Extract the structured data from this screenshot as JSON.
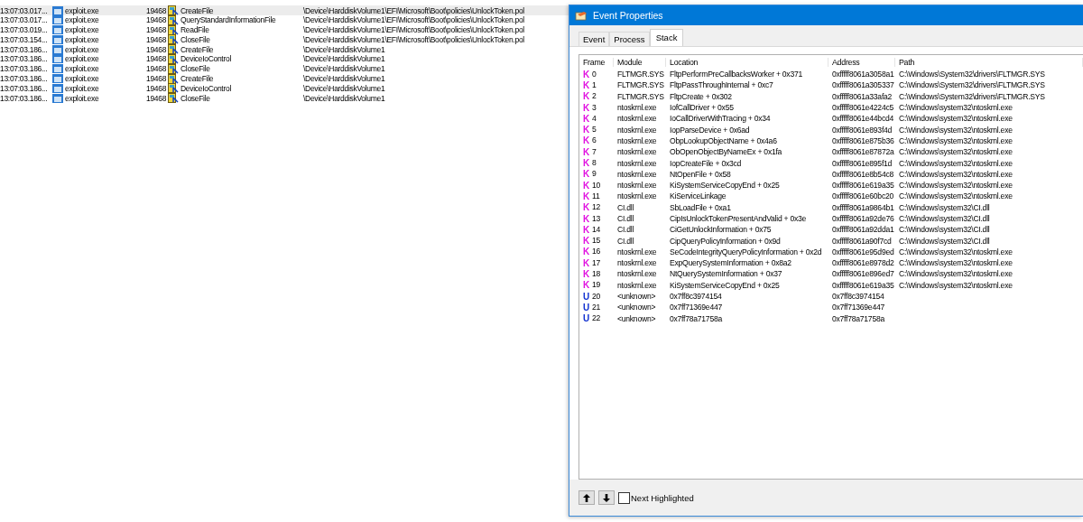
{
  "event_log": {
    "rows": [
      {
        "time": "13:07:03.017...",
        "process": "exploit.exe",
        "pid": "19468",
        "operation": "CreateFile",
        "path": "\\Device\\HarddiskVolume1\\EFI\\Microsoft\\Boot\\policies\\UnlockToken.pol",
        "selected": true
      },
      {
        "time": "13:07:03.017...",
        "process": "exploit.exe",
        "pid": "19468",
        "operation": "QueryStandardInformationFile",
        "path": "\\Device\\HarddiskVolume1\\EFI\\Microsoft\\Boot\\policies\\UnlockToken.pol",
        "selected": false
      },
      {
        "time": "13:07:03.019...",
        "process": "exploit.exe",
        "pid": "19468",
        "operation": "ReadFile",
        "path": "\\Device\\HarddiskVolume1\\EFI\\Microsoft\\Boot\\policies\\UnlockToken.pol",
        "selected": false
      },
      {
        "time": "13:07:03.154...",
        "process": "exploit.exe",
        "pid": "19468",
        "operation": "CloseFile",
        "path": "\\Device\\HarddiskVolume1\\EFI\\Microsoft\\Boot\\policies\\UnlockToken.pol",
        "selected": false
      },
      {
        "time": "13:07:03.186...",
        "process": "exploit.exe",
        "pid": "19468",
        "operation": "CreateFile",
        "path": "\\Device\\HarddiskVolume1",
        "selected": false
      },
      {
        "time": "13:07:03.186...",
        "process": "exploit.exe",
        "pid": "19468",
        "operation": "DeviceIoControl",
        "path": "\\Device\\HarddiskVolume1",
        "selected": false
      },
      {
        "time": "13:07:03.186...",
        "process": "exploit.exe",
        "pid": "19468",
        "operation": "CloseFile",
        "path": "\\Device\\HarddiskVolume1",
        "selected": false
      },
      {
        "time": "13:07:03.186...",
        "process": "exploit.exe",
        "pid": "19468",
        "operation": "CreateFile",
        "path": "\\Device\\HarddiskVolume1",
        "selected": false
      },
      {
        "time": "13:07:03.186...",
        "process": "exploit.exe",
        "pid": "19468",
        "operation": "DeviceIoControl",
        "path": "\\Device\\HarddiskVolume1",
        "selected": false
      },
      {
        "time": "13:07:03.186...",
        "process": "exploit.exe",
        "pid": "19468",
        "operation": "CloseFile",
        "path": "\\Device\\HarddiskVolume1",
        "selected": false
      }
    ]
  },
  "dialog": {
    "title": "Event Properties",
    "tabs": [
      {
        "label": "Event",
        "selected": false
      },
      {
        "label": "Process",
        "selected": false
      },
      {
        "label": "Stack",
        "selected": true
      }
    ],
    "stack": {
      "columns": [
        "Frame",
        "Module",
        "Location",
        "Address",
        "Path"
      ],
      "rows": [
        {
          "mode": "K",
          "color": "#e010e0",
          "frame": "0",
          "module": "FLTMGR.SYS",
          "location": "FltpPerformPreCallbacksWorker + 0x371",
          "address": "0xfffff8061a3058a1",
          "path": "C:\\Windows\\System32\\drivers\\FLTMGR.SYS"
        },
        {
          "mode": "K",
          "color": "#e010e0",
          "frame": "1",
          "module": "FLTMGR.SYS",
          "location": "FltpPassThroughInternal + 0xc7",
          "address": "0xfffff8061a305337",
          "path": "C:\\Windows\\System32\\drivers\\FLTMGR.SYS"
        },
        {
          "mode": "K",
          "color": "#e010e0",
          "frame": "2",
          "module": "FLTMGR.SYS",
          "location": "FltpCreate + 0x302",
          "address": "0xfffff8061a33afa2",
          "path": "C:\\Windows\\System32\\drivers\\FLTMGR.SYS"
        },
        {
          "mode": "K",
          "color": "#e010e0",
          "frame": "3",
          "module": "ntoskrnl.exe",
          "location": "IofCallDriver + 0x55",
          "address": "0xfffff8061e4224c5",
          "path": "C:\\Windows\\system32\\ntoskrnl.exe"
        },
        {
          "mode": "K",
          "color": "#e010e0",
          "frame": "4",
          "module": "ntoskrnl.exe",
          "location": "IoCallDriverWithTracing + 0x34",
          "address": "0xfffff8061e44bcd4",
          "path": "C:\\Windows\\system32\\ntoskrnl.exe"
        },
        {
          "mode": "K",
          "color": "#e010e0",
          "frame": "5",
          "module": "ntoskrnl.exe",
          "location": "IopParseDevice + 0x6ad",
          "address": "0xfffff8061e893f4d",
          "path": "C:\\Windows\\system32\\ntoskrnl.exe"
        },
        {
          "mode": "K",
          "color": "#e010e0",
          "frame": "6",
          "module": "ntoskrnl.exe",
          "location": "ObpLookupObjectName + 0x4a6",
          "address": "0xfffff8061e875b36",
          "path": "C:\\Windows\\system32\\ntoskrnl.exe"
        },
        {
          "mode": "K",
          "color": "#e010e0",
          "frame": "7",
          "module": "ntoskrnl.exe",
          "location": "ObOpenObjectByNameEx + 0x1fa",
          "address": "0xfffff8061e87872a",
          "path": "C:\\Windows\\system32\\ntoskrnl.exe"
        },
        {
          "mode": "K",
          "color": "#e010e0",
          "frame": "8",
          "module": "ntoskrnl.exe",
          "location": "IopCreateFile + 0x3cd",
          "address": "0xfffff8061e895f1d",
          "path": "C:\\Windows\\system32\\ntoskrnl.exe"
        },
        {
          "mode": "K",
          "color": "#e010e0",
          "frame": "9",
          "module": "ntoskrnl.exe",
          "location": "NtOpenFile + 0x58",
          "address": "0xfffff8061e8b54c8",
          "path": "C:\\Windows\\system32\\ntoskrnl.exe"
        },
        {
          "mode": "K",
          "color": "#e010e0",
          "frame": "10",
          "module": "ntoskrnl.exe",
          "location": "KiSystemServiceCopyEnd + 0x25",
          "address": "0xfffff8061e619a35",
          "path": "C:\\Windows\\system32\\ntoskrnl.exe"
        },
        {
          "mode": "K",
          "color": "#e010e0",
          "frame": "11",
          "module": "ntoskrnl.exe",
          "location": "KiServiceLinkage",
          "address": "0xfffff8061e60bc20",
          "path": "C:\\Windows\\system32\\ntoskrnl.exe"
        },
        {
          "mode": "K",
          "color": "#e010e0",
          "frame": "12",
          "module": "CI.dll",
          "location": "SbLoadFile + 0xa1",
          "address": "0xfffff8061a9864b1",
          "path": "C:\\Windows\\system32\\CI.dll"
        },
        {
          "mode": "K",
          "color": "#e010e0",
          "frame": "13",
          "module": "CI.dll",
          "location": "CipIsUnlockTokenPresentAndValid + 0x3e",
          "address": "0xfffff8061a92de76",
          "path": "C:\\Windows\\system32\\CI.dll"
        },
        {
          "mode": "K",
          "color": "#e010e0",
          "frame": "14",
          "module": "CI.dll",
          "location": "CiGetUnlockInformation + 0x75",
          "address": "0xfffff8061a92dda1",
          "path": "C:\\Windows\\system32\\CI.dll"
        },
        {
          "mode": "K",
          "color": "#e010e0",
          "frame": "15",
          "module": "CI.dll",
          "location": "CipQueryPolicyInformation + 0x9d",
          "address": "0xfffff8061a90f7cd",
          "path": "C:\\Windows\\system32\\CI.dll"
        },
        {
          "mode": "K",
          "color": "#e010e0",
          "frame": "16",
          "module": "ntoskrnl.exe",
          "location": "SeCodeIntegrityQueryPolicyInformation + 0x2d",
          "address": "0xfffff8061e95d9ed",
          "path": "C:\\Windows\\system32\\ntoskrnl.exe"
        },
        {
          "mode": "K",
          "color": "#e010e0",
          "frame": "17",
          "module": "ntoskrnl.exe",
          "location": "ExpQuerySystemInformation + 0x8a2",
          "address": "0xfffff8061e8978d2",
          "path": "C:\\Windows\\system32\\ntoskrnl.exe"
        },
        {
          "mode": "K",
          "color": "#e010e0",
          "frame": "18",
          "module": "ntoskrnl.exe",
          "location": "NtQuerySystemInformation + 0x37",
          "address": "0xfffff8061e896ed7",
          "path": "C:\\Windows\\system32\\ntoskrnl.exe"
        },
        {
          "mode": "K",
          "color": "#e010e0",
          "frame": "19",
          "module": "ntoskrnl.exe",
          "location": "KiSystemServiceCopyEnd + 0x25",
          "address": "0xfffff8061e619a35",
          "path": "C:\\Windows\\system32\\ntoskrnl.exe"
        },
        {
          "mode": "U",
          "color": "#1030d0",
          "frame": "20",
          "module": "<unknown>",
          "location": "0x7ff8c3974154",
          "address": "0x7ff8c3974154"
        },
        {
          "mode": "U",
          "color": "#1030d0",
          "frame": "21",
          "module": "<unknown>",
          "location": "0x7ff71369e447",
          "address": "0x7ff71369e447"
        },
        {
          "mode": "U",
          "color": "#1030d0",
          "frame": "22",
          "module": "<unknown>",
          "location": "0x7ff78a71758a",
          "address": "0x7ff78a71758a"
        }
      ]
    },
    "next_highlighted": {
      "label": "Next Highlighted",
      "checked": false
    }
  }
}
